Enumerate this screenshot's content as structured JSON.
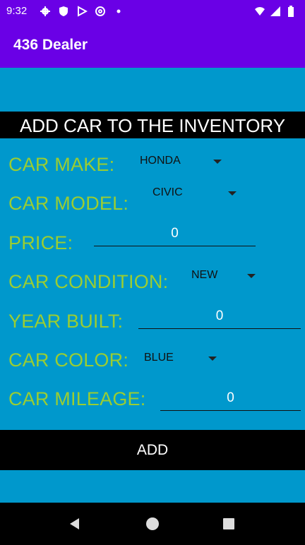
{
  "status_bar": {
    "time": "9:32"
  },
  "app": {
    "title": "436 Dealer"
  },
  "form": {
    "heading": "ADD CAR TO THE INVENTORY",
    "make_label": "CAR MAKE:",
    "make_value": "HONDA",
    "model_label": "CAR MODEL:",
    "model_value": "CIVIC",
    "price_label": "PRICE:",
    "price_value": "0",
    "condition_label": "CAR CONDITION:",
    "condition_value": "NEW",
    "year_label": "YEAR BUILT:",
    "year_value": "0",
    "color_label": "CAR COLOR:",
    "color_value": "BLUE",
    "mileage_label": "CAR MILEAGE:",
    "mileage_value": "0",
    "add_label": "ADD"
  },
  "colors": {
    "accent": "#6A00E6",
    "background": "#0098CC",
    "label": "#9ACD32",
    "bar": "#000000"
  },
  "icons": [
    "gear-icon",
    "shield-icon",
    "play-store-icon",
    "at-sign-icon",
    "dot-icon",
    "wifi-icon",
    "cellular-icon",
    "battery-icon",
    "back-icon",
    "home-icon",
    "recents-icon"
  ]
}
